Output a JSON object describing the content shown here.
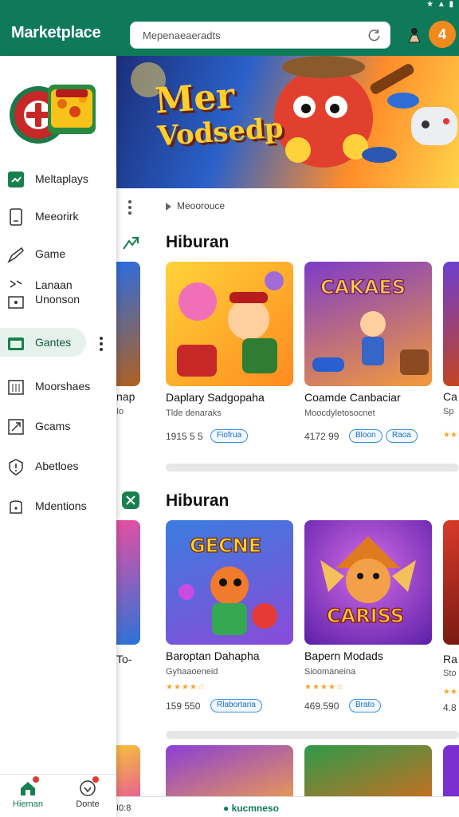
{
  "app": {
    "title": "Marketplace"
  },
  "status": {
    "icons": "★ ▲ ▮"
  },
  "search": {
    "placeholder": "Mepenaeaeradts"
  },
  "notif": {
    "label": "4"
  },
  "drawer": {
    "items": [
      {
        "label": "Meltaplays",
        "icon": "store-icon"
      },
      {
        "label": "Meeorirk",
        "icon": "document-icon"
      },
      {
        "label": "Game",
        "icon": "pen-icon"
      },
      {
        "label": "Lanaan\nUnonson",
        "icon": "share-icon"
      },
      {
        "label": "Gantes",
        "icon": "folder-icon",
        "active": true
      },
      {
        "label": "Moorshaes",
        "icon": "calendar-icon"
      },
      {
        "label": "Gcams",
        "icon": "expand-icon"
      },
      {
        "label": "Abetloes",
        "icon": "info-icon"
      },
      {
        "label": "Mdentions",
        "icon": "circle-icon"
      }
    ],
    "bottom": [
      {
        "label": "Hieman",
        "icon": "home-icon"
      },
      {
        "label": "Donte",
        "icon": "heart-icon"
      }
    ]
  },
  "banner": {
    "title_line1": "Mer",
    "title_line2": "Vodsedp"
  },
  "breadcrumb": {
    "text": "Meoorouce"
  },
  "sections": [
    {
      "title": "Hiburan",
      "cards": [
        {
          "name": "Daplary Sadgopaha",
          "sub": "Tlde denaraks",
          "price": "1915 5 5",
          "stars": "",
          "tags": [
            "Fiofrua"
          ]
        },
        {
          "name": "Coamde Canbaciar",
          "sub": "Moocdyletosocnet",
          "price": "4172 99",
          "stars": "",
          "tags": [
            "Bloon",
            "Raoa"
          ]
        }
      ],
      "partial_left": {
        "name": "nap",
        "sub": "Io"
      },
      "partial_right": {
        "name": "Ca",
        "sub": "Sp",
        "stars": "★★"
      }
    },
    {
      "title": "Hiburan",
      "cards": [
        {
          "name": "Baroptan Dahapha",
          "sub": "Gyhaaoeneid",
          "price": "159 550",
          "stars": "★★★★☆",
          "tags": [
            "Rlabortaria"
          ]
        },
        {
          "name": "Bapern Modads",
          "sub": "Sioomaneina",
          "price": "469.590",
          "stars": "★★★★☆",
          "tags": [
            "Brato"
          ]
        }
      ],
      "partial_left": {
        "name": "To-",
        "sub": ""
      },
      "partial_right": {
        "name": "Ra",
        "sub": "Sto",
        "stars": "★★",
        "price": "4.8"
      }
    }
  ],
  "bottom_strip": {
    "left": "I0:8",
    "center": "● kucmneso"
  },
  "colors": {
    "brand": "#0f7a5a",
    "accent": "#f08a1d",
    "pill": "#3a8de0"
  }
}
